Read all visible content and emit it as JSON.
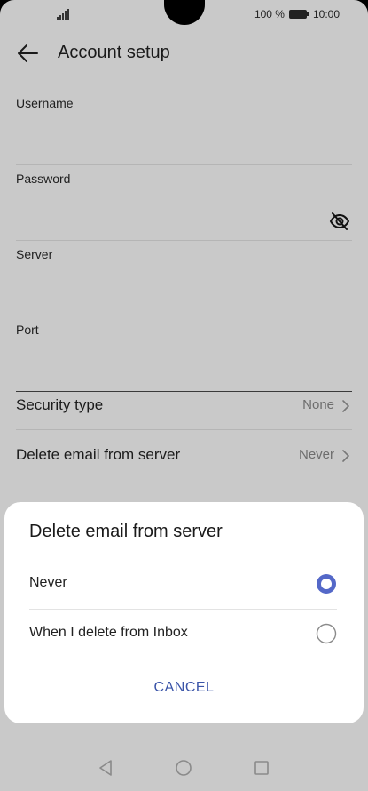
{
  "status_bar": {
    "battery_text": "100 %",
    "time": "10:00",
    "icons": [
      "signal-icon",
      "battery-icon"
    ]
  },
  "header": {
    "title": "Account setup",
    "back_icon": "back-arrow-icon"
  },
  "form": {
    "fields": [
      {
        "label": "Username",
        "value": ""
      },
      {
        "label": "Password",
        "value": "",
        "icon": "eye-off-icon"
      },
      {
        "label": "Server",
        "value": ""
      },
      {
        "label": "Port",
        "value": ""
      }
    ],
    "rows": [
      {
        "label": "Security type",
        "value": "None"
      },
      {
        "label": "Delete email from server",
        "value": "Never"
      }
    ]
  },
  "dialog": {
    "title": "Delete email from server",
    "options": [
      {
        "label": "Never",
        "selected": true
      },
      {
        "label": "When I delete from Inbox",
        "selected": false
      }
    ],
    "cancel_label": "CANCEL"
  },
  "nav_bar": {
    "icons": [
      "back-triangle-icon",
      "home-circle-icon",
      "recents-square-icon"
    ]
  },
  "colors": {
    "accent": "#5468c8",
    "dim_background": "#c9c9c9",
    "dialog_background": "#ffffff",
    "cancel_text": "#3a54a8"
  }
}
